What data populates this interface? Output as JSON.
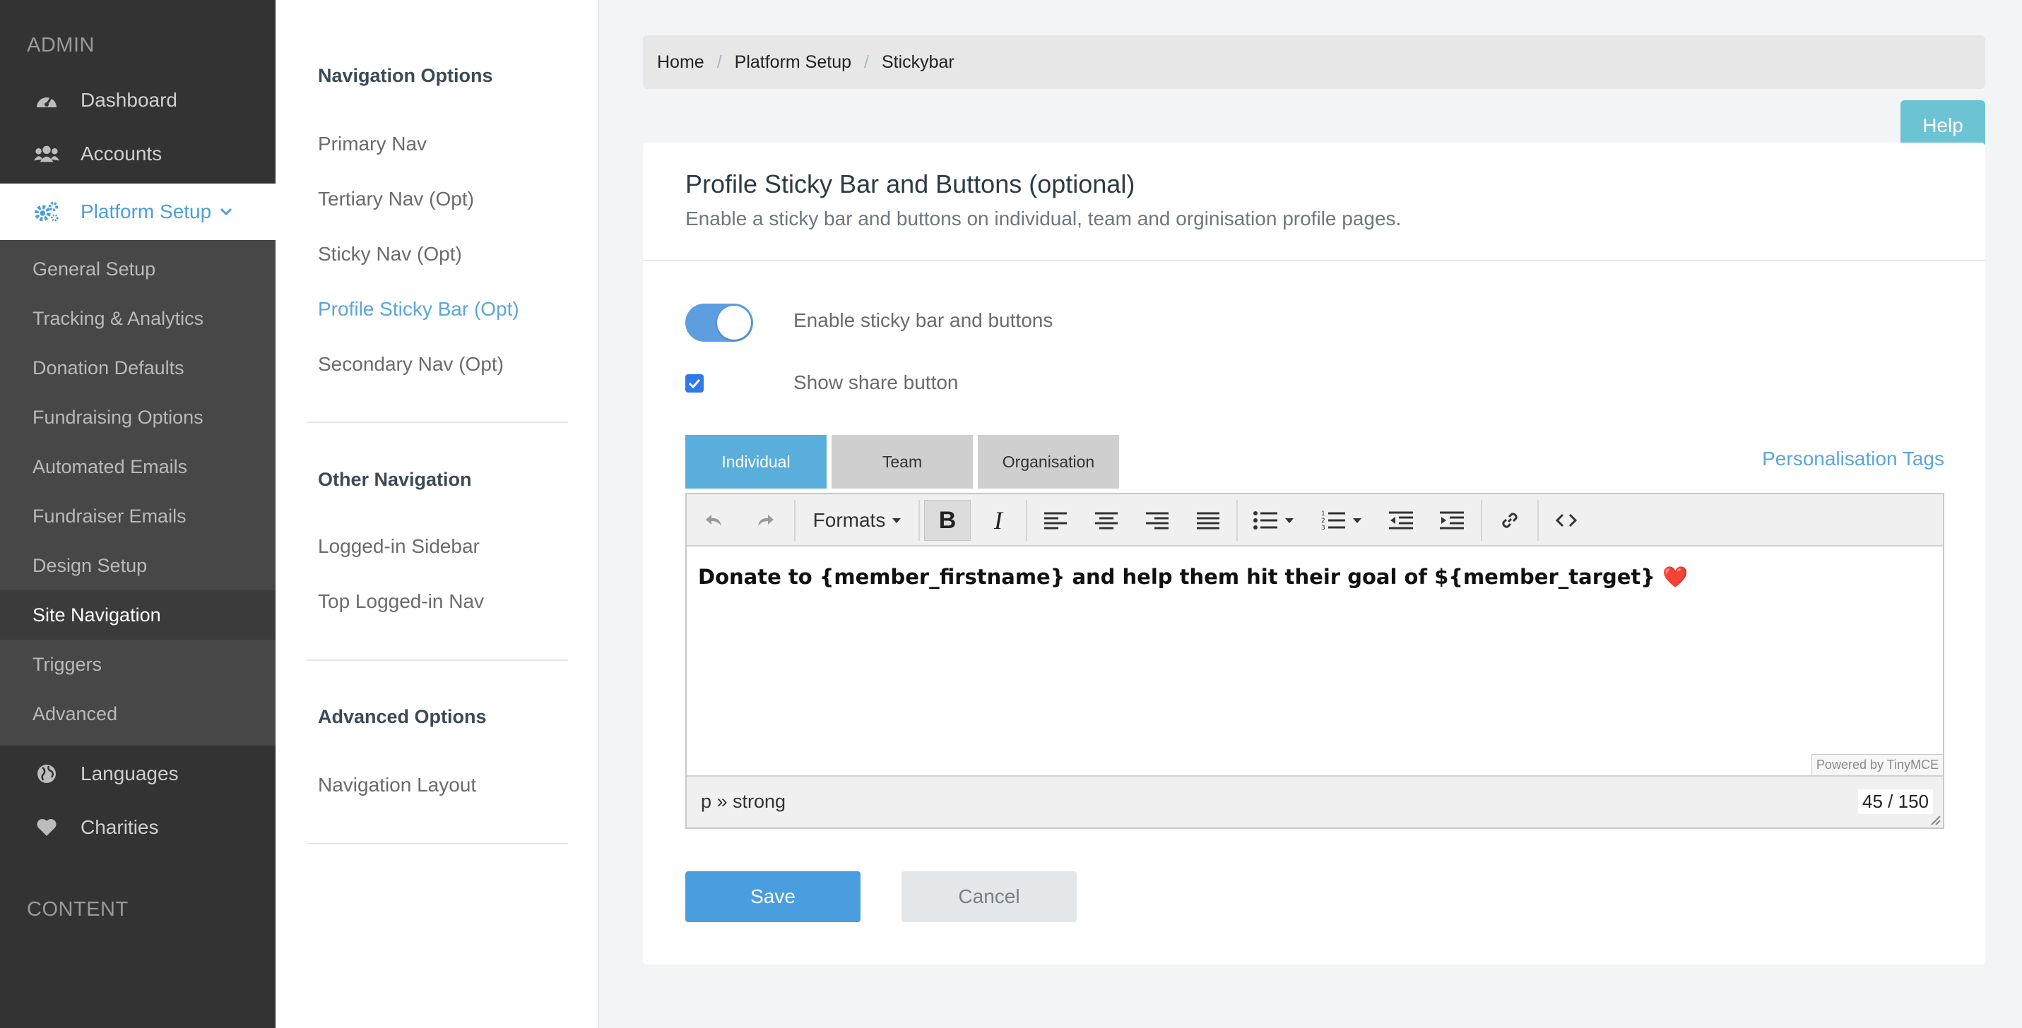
{
  "sidebar": {
    "section_admin": "ADMIN",
    "section_content": "CONTENT",
    "items": [
      {
        "label": "Dashboard",
        "icon": "dashboard-icon"
      },
      {
        "label": "Accounts",
        "icon": "users-icon"
      },
      {
        "label": "Platform Setup",
        "icon": "gears-icon"
      },
      {
        "label": "Languages",
        "icon": "globe-icon"
      },
      {
        "label": "Charities",
        "icon": "heart-icon"
      }
    ],
    "sub_items": [
      "General Setup",
      "Tracking & Analytics",
      "Donation Defaults",
      "Fundraising Options",
      "Automated Emails",
      "Fundraiser Emails",
      "Design Setup",
      "Site Navigation",
      "Triggers",
      "Advanced"
    ],
    "active_sub": "Site Navigation"
  },
  "subnav": {
    "groups": [
      {
        "heading": "Navigation Options",
        "links": [
          "Primary Nav",
          "Tertiary Nav (Opt)",
          "Sticky Nav (Opt)",
          "Profile Sticky Bar (Opt)",
          "Secondary Nav (Opt)"
        ]
      },
      {
        "heading": "Other Navigation",
        "links": [
          "Logged-in Sidebar",
          "Top Logged-in Nav"
        ]
      },
      {
        "heading": "Advanced Options",
        "links": [
          "Navigation Layout"
        ]
      }
    ],
    "active_link": "Profile Sticky Bar (Opt)"
  },
  "breadcrumb": [
    "Home",
    "Platform Setup",
    "Stickybar"
  ],
  "help_label": "Help",
  "card": {
    "title": "Profile Sticky Bar and Buttons (optional)",
    "subtitle": "Enable a sticky bar and buttons on individual, team and orginisation profile pages.",
    "toggle_label": "Enable sticky bar and buttons",
    "toggle_on": true,
    "checkbox_label": "Show share button",
    "checkbox_checked": true,
    "tabs": [
      "Individual",
      "Team",
      "Organisation"
    ],
    "active_tab": "Individual",
    "personalisation_link": "Personalisation Tags"
  },
  "editor": {
    "formats_label": "Formats",
    "content": "Donate to {member_firstname} and help them hit their goal of ${member_target} ❤️",
    "powered_by": "Powered by TinyMCE",
    "path": "p » strong",
    "word_count": "45 / 150"
  },
  "buttons": {
    "save": "Save",
    "cancel": "Cancel"
  },
  "colors": {
    "accent": "#4a9ee0",
    "sidebar": "#333333",
    "help": "#6cc3d4"
  }
}
